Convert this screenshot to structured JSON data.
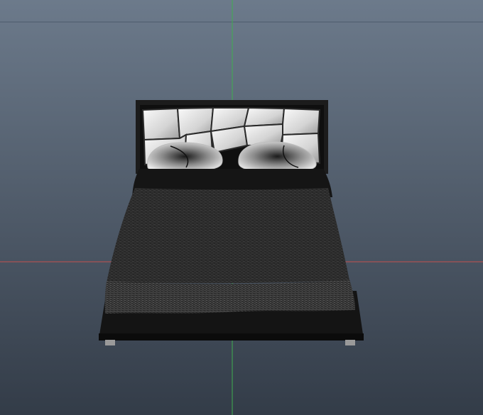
{
  "viewport": {
    "view": "3d-perspective",
    "background_top": "#6c7a8b",
    "background_bottom": "#333c48",
    "axes": {
      "x_axis_color": "#c4504f",
      "y_axis_color": "#3fae4f",
      "grid_line_color": "#4b5a6c"
    }
  },
  "model": {
    "object": "bed",
    "materials": {
      "frame_color": "#1a1a1a",
      "headboard_panel_color": "#e6e6e6",
      "pillow_color": "#d9d9d9",
      "blanket_color": "#2b2b2b",
      "blanket_fold_color": "#3a3a3a",
      "sheet_color": "#151515",
      "legs_color": "#9a9a9a"
    }
  }
}
